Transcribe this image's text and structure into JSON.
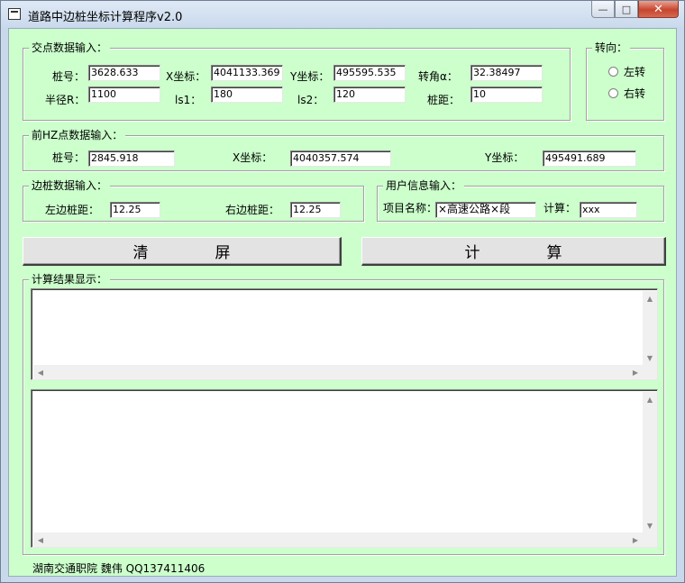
{
  "window": {
    "title": "道路中边桩坐标计算程序v2.0",
    "min_glyph": "—",
    "max_glyph": "□",
    "close_glyph": "✕"
  },
  "intersection": {
    "frame_title": "交点数据输入：",
    "station_label": "桩号：",
    "station_value": "3628.633",
    "x_label": "X坐标：",
    "x_value": "4041133.369",
    "y_label": "Y坐标：",
    "y_value": "495595.535",
    "angle_label": "转角α：",
    "angle_value": "32.38497",
    "radius_label": "半径R：",
    "radius_value": "1100",
    "ls1_label": "ls1：",
    "ls1_value": "180",
    "ls2_label": "ls2：",
    "ls2_value": "120",
    "spacing_label": "桩距：",
    "spacing_value": "10"
  },
  "direction": {
    "frame_title": "转向：",
    "left_label": "左转",
    "right_label": "右转"
  },
  "prev_hz": {
    "frame_title": "前HZ点数据输入：",
    "station_label": "桩号：",
    "station_value": "2845.918",
    "x_label": "X坐标：",
    "x_value": "4040357.574",
    "y_label": "Y坐标：",
    "y_value": "495491.689"
  },
  "side_stake": {
    "frame_title": "边桩数据输入：",
    "left_label": "左边桩距：",
    "left_value": "12.25",
    "right_label": "右边桩距：",
    "right_value": "12.25"
  },
  "user_info": {
    "frame_title": "用户信息输入：",
    "project_label": "项目名称：",
    "project_value": "×高速公路×段",
    "calc_label": "计算：",
    "calc_value": "xxx"
  },
  "buttons": {
    "clear_1": "清",
    "clear_2": "屏",
    "calc_1": "计",
    "calc_2": "算"
  },
  "results": {
    "frame_title": "计算结果显示："
  },
  "footer": {
    "credit": "湖南交通职院 魏伟 QQ137411406"
  },
  "colors": {
    "client_bg": "#ccffcc",
    "close_button": "#c8452f"
  },
  "icons": {
    "scroll_up": "▲",
    "scroll_down": "▼",
    "scroll_left": "◀",
    "scroll_right": "▶"
  }
}
